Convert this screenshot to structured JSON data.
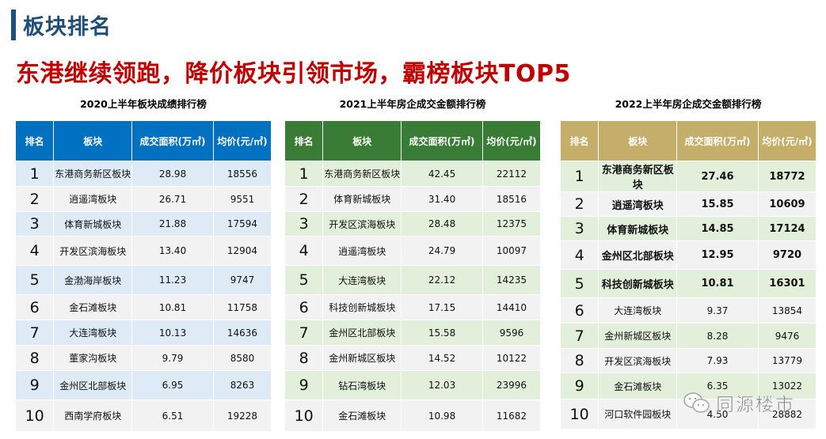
{
  "section_title": "板块排名",
  "headline": "东港继续领跑，降价板块引领市场，霸榜板块TOP5",
  "columns": [
    "排名",
    "板块",
    "成交面积(万㎡)",
    "均价(元/㎡)"
  ],
  "tables": [
    {
      "title": "2020上半年板块成绩排行榜",
      "rows": [
        [
          "1",
          "东港商务新区板块",
          "28.98",
          "18556"
        ],
        [
          "2",
          "逍遥湾板块",
          "26.71",
          "9551"
        ],
        [
          "3",
          "体育新城板块",
          "21.88",
          "17594"
        ],
        [
          "4",
          "开发区滨海板块",
          "13.40",
          "12904"
        ],
        [
          "5",
          "金渤海岸板块",
          "11.23",
          "9747"
        ],
        [
          "6",
          "金石滩板块",
          "10.81",
          "11758"
        ],
        [
          "7",
          "大连湾板块",
          "10.13",
          "14636"
        ],
        [
          "8",
          "董家沟板块",
          "9.79",
          "8580"
        ],
        [
          "9",
          "金州区北部板块",
          "6.95",
          "8263"
        ],
        [
          "10",
          "西南学府板块",
          "6.51",
          "19228"
        ]
      ]
    },
    {
      "title": "2021上半年房企成交金额排行榜",
      "rows": [
        [
          "1",
          "东港商务新区板块",
          "42.45",
          "22112"
        ],
        [
          "2",
          "体育新城板块",
          "31.40",
          "18516"
        ],
        [
          "3",
          "开发区滨海板块",
          "28.48",
          "12375"
        ],
        [
          "4",
          "逍遥湾板块",
          "24.79",
          "10097"
        ],
        [
          "5",
          "大连湾板块",
          "22.12",
          "14235"
        ],
        [
          "6",
          "科技创新城板块",
          "17.15",
          "14410"
        ],
        [
          "7",
          "金州区北部板块",
          "15.58",
          "9596"
        ],
        [
          "8",
          "金州新城区板块",
          "14.52",
          "10122"
        ],
        [
          "9",
          "钻石湾板块",
          "12.03",
          "23996"
        ],
        [
          "10",
          "金石滩板块",
          "10.98",
          "11682"
        ]
      ]
    },
    {
      "title": "2022上半年房企成交金额排行榜",
      "rows": [
        [
          "1",
          "东港商务新区板块",
          "27.46",
          "18772"
        ],
        [
          "2",
          "逍遥湾板块",
          "15.85",
          "10609"
        ],
        [
          "3",
          "体育新城板块",
          "14.85",
          "17124"
        ],
        [
          "4",
          "金州区北部板块",
          "12.95",
          "9720"
        ],
        [
          "5",
          "科技创新城板块",
          "10.81",
          "16301"
        ],
        [
          "6",
          "大连湾板块",
          "9.37",
          "13854"
        ],
        [
          "7",
          "金州新城区板块",
          "8.28",
          "9476"
        ],
        [
          "8",
          "开发区滨海板块",
          "7.93",
          "13779"
        ],
        [
          "9",
          "金石滩板块",
          "6.35",
          "13022"
        ],
        [
          "10",
          "河口软件园板块",
          "4.50",
          "28882"
        ]
      ]
    }
  ],
  "watermark": "同源楼市"
}
